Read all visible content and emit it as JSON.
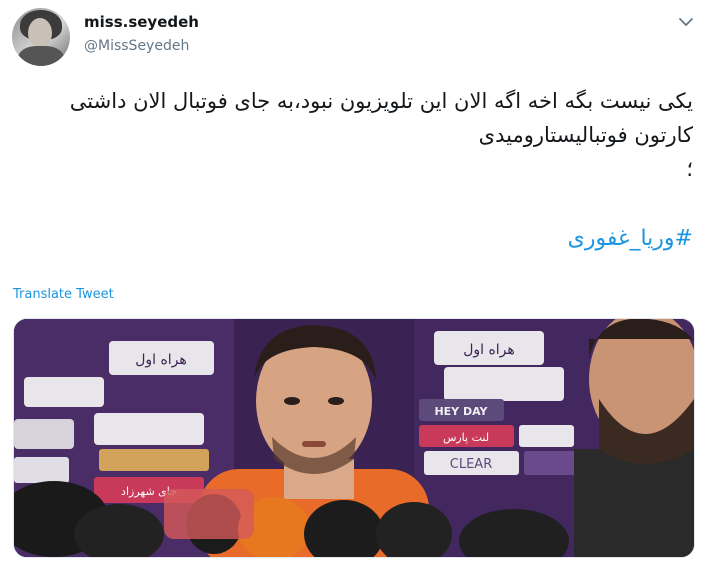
{
  "author": {
    "display_name": "miss.seyedeh",
    "username": "@MissSeyedeh"
  },
  "tweet": {
    "lines": [
      "یکی نیست بگه اخه اگه الان این تلویزیون نبود،به جای فوتبال الان داشتی",
      "کارتون فوتبالیستارومیدی",
      "؛"
    ],
    "hashtag": "#وریا_غفوری",
    "translate_label": "Translate Tweet"
  },
  "media": {
    "alt": "Video frame of a football player being interviewed in front of a sponsor backdrop with microphones",
    "backdrop_text": {
      "sponsor_1": "هراه اول",
      "hey_day": "HEY DAY",
      "clear": "CLEAR",
      "brand_2": "لنت پارس",
      "shahrzad": "جای شهرزاد"
    }
  },
  "icons": {
    "caret": "chevron-down-icon"
  },
  "colors": {
    "link": "#1b95e0",
    "text": "#14171a",
    "muted": "#657786"
  }
}
